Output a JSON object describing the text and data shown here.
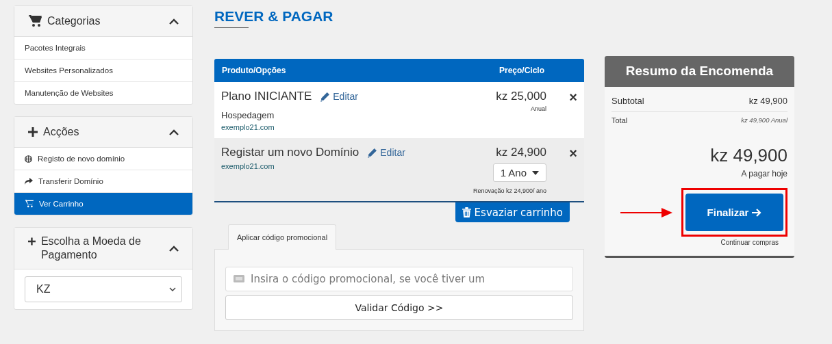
{
  "sidebar": {
    "panels": [
      {
        "kind": "categories",
        "title": "Categorias",
        "expanded": true,
        "items": [
          {
            "label": "Pacotes Integrais",
            "selected": false
          },
          {
            "label": "Websites Personalizados",
            "selected": false
          },
          {
            "label": "Manutenção de Websites",
            "selected": false
          }
        ]
      },
      {
        "kind": "actions",
        "title": "Acções",
        "expanded": true,
        "items": [
          {
            "label": "Registo de novo domínio",
            "selected": false
          },
          {
            "label": "Transferir Domínio",
            "selected": false
          },
          {
            "label": "Ver Carrinho",
            "selected": true
          }
        ]
      },
      {
        "kind": "currency",
        "title": "Escolha a Moeda de Pagamento",
        "expanded": true,
        "select": "KZ"
      }
    ]
  },
  "page_title": "REVER & PAGAR",
  "cart": {
    "columns": [
      "Produto/Opções",
      "Preço/Ciclo"
    ],
    "items": [
      {
        "name": "Plano INICIANTE",
        "edit": "Editar",
        "group": "Hospedagem",
        "domain": "exemplo21.com",
        "price": "kz 25,000",
        "cycle": "Anual",
        "remove": "×"
      },
      {
        "name": "Registar um novo Domínio",
        "edit": "Editar",
        "domain": "exemplo21.com",
        "price": "kz 24,900",
        "term": "1 Ano",
        "renewal": "Renovação kz 24,900/ ano",
        "remove": "×"
      }
    ],
    "empty_button": "Esvaziar carrinho"
  },
  "promo": {
    "tab": "Aplicar código promocional",
    "placeholder": "Insira o código promocional, se você tiver um",
    "button": "Validar Código >>"
  },
  "summary": {
    "title": "Resumo da Encomenda",
    "subtotal_label": "Subtotal",
    "subtotal": "kz 49,900",
    "total_label": "Total",
    "total": "kz 49,900 Anual",
    "amount": "kz 49,900",
    "due": "A pagar hoje",
    "checkout": "Finalizar",
    "continue": "Continuar compras",
    "checkout_highlighted": true
  }
}
